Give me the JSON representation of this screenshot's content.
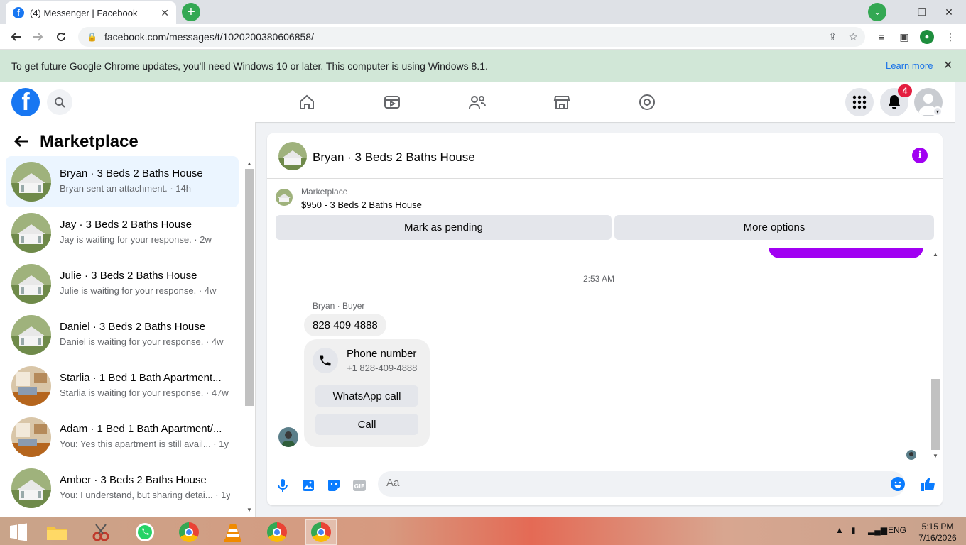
{
  "browser": {
    "tab_title": "(4) Messenger | Facebook",
    "url": "facebook.com/messages/t/1020200380606858/",
    "infobar_text": "To get future Google Chrome updates, you'll need Windows 10 or later. This computer is using Windows 8.1.",
    "infobar_link": "Learn more"
  },
  "facebook": {
    "notification_count": "4"
  },
  "sidebar": {
    "title": "Marketplace",
    "conversations": [
      {
        "name": "Bryan · 3 Beds 2 Baths House",
        "preview": "Bryan sent an attachment. · 14h",
        "active": true
      },
      {
        "name": "Jay · 3 Beds 2 Baths House",
        "preview": "Jay is waiting for your response. · 2w"
      },
      {
        "name": "Julie · 3 Beds 2 Baths House",
        "preview": "Julie is waiting for your response. · 4w"
      },
      {
        "name": "Daniel · 3 Beds 2 Baths House",
        "preview": "Daniel is waiting for your response. · 4w"
      },
      {
        "name": "Starlia · 1 Bed 1 Bath Apartment...",
        "preview": "Starlia is waiting for your response. · 47w"
      },
      {
        "name": "Adam · 1 Bed 1 Bath Apartment/...",
        "preview": "You: Yes this apartment is still avail... · 1y"
      },
      {
        "name": "Amber · 3 Beds 2 Baths House",
        "preview": "You: I understand, but sharing detai... · 1y"
      }
    ]
  },
  "chat": {
    "title": "Bryan · 3 Beds 2 Baths House",
    "listing_category": "Marketplace",
    "listing_price_title": "$950 - 3 Beds 2 Baths House",
    "mark_pending_label": "Mark as pending",
    "more_options_label": "More options",
    "timestamp": "2:53 AM",
    "sender_label": "Bryan · Buyer",
    "message_text": "828 409 4888",
    "phone_card": {
      "title": "Phone number",
      "number": "+1 828-409-4888",
      "whatsapp_label": "WhatsApp call",
      "call_label": "Call"
    },
    "composer_placeholder": "Aa"
  },
  "taskbar": {
    "language": "ENG",
    "time": "5:15 PM",
    "date": "7/16/2026"
  },
  "colors": {
    "facebook_blue": "#1877f2",
    "messenger_purple": "#a100f2",
    "notification_red": "#e41e3f",
    "infobar_green": "#d1e7d7"
  }
}
